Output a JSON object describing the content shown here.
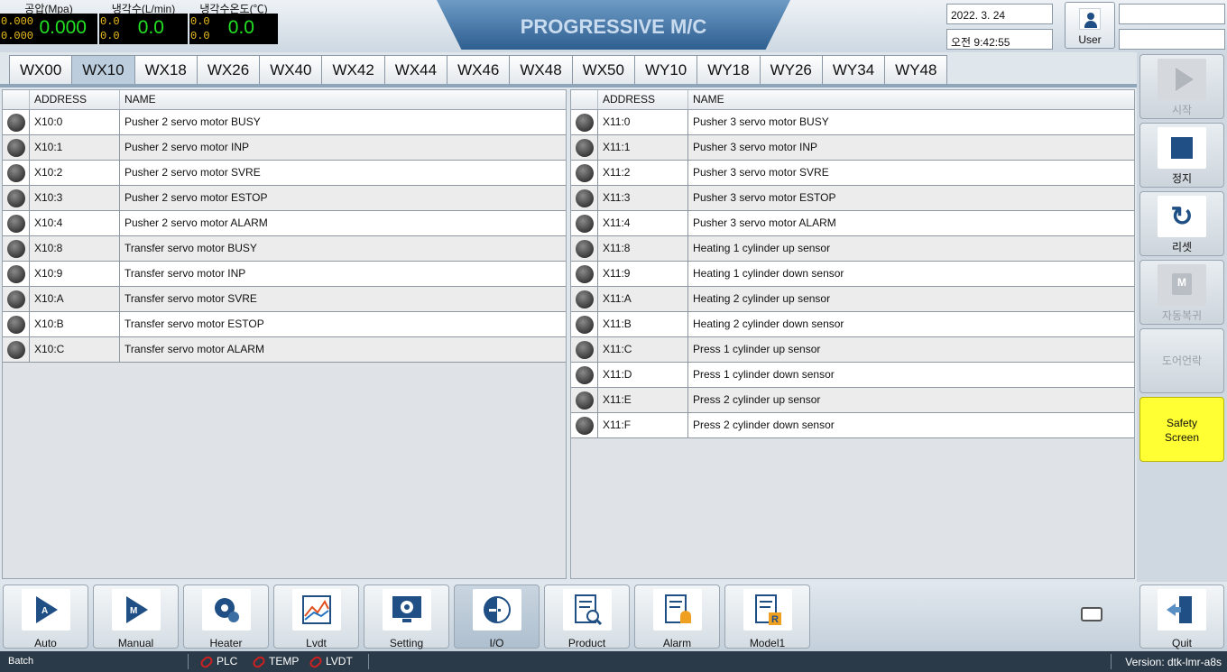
{
  "header": {
    "title": "PROGRESSIVE M/C",
    "date": "2022. 3. 24",
    "time": "오전 9:42:55",
    "user_label": "User",
    "gauges": [
      {
        "label": "공압(Mpa)",
        "small1": "0.000",
        "small2": "0.000",
        "value": "0.000"
      },
      {
        "label": "냉각수(L/min)",
        "small1": "0.0",
        "small2": "0.0",
        "value": "0.0"
      },
      {
        "label": "냉각수온도(℃)",
        "small1": "0.0",
        "small2": "0.0",
        "value": "0.0"
      }
    ]
  },
  "tabs": [
    "WX00",
    "WX10",
    "WX18",
    "WX26",
    "WX40",
    "WX42",
    "WX44",
    "WX46",
    "WX48",
    "WX50",
    "WY10",
    "WY18",
    "WY26",
    "WY34",
    "WY48"
  ],
  "active_tab": "WX10",
  "table_headers": {
    "address": "ADDRESS",
    "name": "NAME"
  },
  "left_table": [
    {
      "address": "X10:0",
      "name": "Pusher 2 servo motor BUSY"
    },
    {
      "address": "X10:1",
      "name": "Pusher 2 servo motor INP"
    },
    {
      "address": "X10:2",
      "name": "Pusher 2 servo motor SVRE"
    },
    {
      "address": "X10:3",
      "name": "Pusher 2 servo motor ESTOP"
    },
    {
      "address": "X10:4",
      "name": "Pusher 2 servo motor ALARM"
    },
    {
      "address": "X10:8",
      "name": "Transfer servo motor BUSY"
    },
    {
      "address": "X10:9",
      "name": "Transfer servo motor INP"
    },
    {
      "address": "X10:A",
      "name": "Transfer servo motor SVRE"
    },
    {
      "address": "X10:B",
      "name": "Transfer servo motor ESTOP"
    },
    {
      "address": "X10:C",
      "name": "Transfer servo motor ALARM"
    }
  ],
  "right_table": [
    {
      "address": "X11:0",
      "name": "Pusher 3 servo motor BUSY"
    },
    {
      "address": "X11:1",
      "name": "Pusher 3 servo motor INP"
    },
    {
      "address": "X11:2",
      "name": "Pusher 3 servo motor SVRE"
    },
    {
      "address": "X11:3",
      "name": "Pusher 3 servo motor ESTOP"
    },
    {
      "address": "X11:4",
      "name": "Pusher 3 servo motor ALARM"
    },
    {
      "address": "X11:8",
      "name": "Heating 1 cylinder up sensor"
    },
    {
      "address": "X11:9",
      "name": "Heating 1 cylinder down sensor"
    },
    {
      "address": "X11:A",
      "name": "Heating 2 cylinder up sensor"
    },
    {
      "address": "X11:B",
      "name": "Heating 2 cylinder down sensor"
    },
    {
      "address": "X11:C",
      "name": "Press 1 cylinder up sensor"
    },
    {
      "address": "X11:D",
      "name": "Press 1 cylinder down sensor"
    },
    {
      "address": "X11:E",
      "name": "Press 2 cylinder up sensor"
    },
    {
      "address": "X11:F",
      "name": "Press 2 cylinder down sensor"
    }
  ],
  "side_buttons": {
    "start": "시작",
    "stop": "정지",
    "reset": "리셋",
    "auto_return": "자동복귀",
    "auto_return_icon_text": "M",
    "door_unlock": "도어언락",
    "safety_line1": "Safety",
    "safety_line2": "Screen"
  },
  "bottom_buttons": [
    "Auto",
    "Manual",
    "Heater",
    "Lvdt",
    "Setting",
    "I/O",
    "Product",
    "Alarm",
    "Model1"
  ],
  "bottom_icon_text": {
    "auto": "A",
    "manual": "M",
    "model": "R"
  },
  "active_bottom": "I/O",
  "quit_label": "Quit",
  "status": {
    "batch": "Batch",
    "plc": "PLC",
    "temp": "TEMP",
    "lvdt": "LVDT",
    "version": "Version: dtk-lmr-a8s"
  },
  "colors": {
    "safety": "#ffff33",
    "gauge_value": "#22e022",
    "gauge_small": "#f0c020",
    "link_error": "#d02020"
  }
}
